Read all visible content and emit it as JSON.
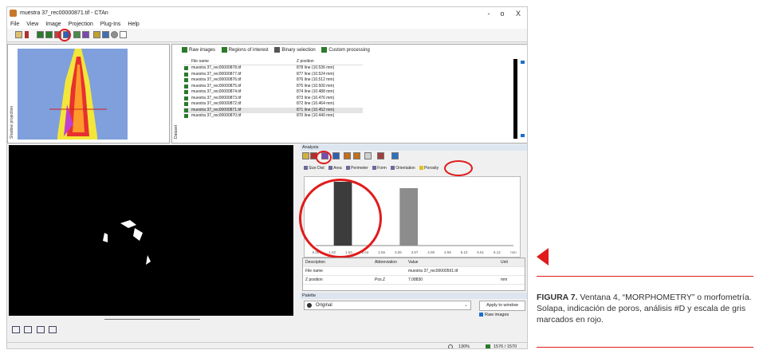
{
  "window": {
    "title": "muestra 37_rec00000871.tif - CTAn",
    "controls": [
      "-",
      "o",
      "X"
    ]
  },
  "menu": [
    "File",
    "View",
    "Image",
    "Projection",
    "Plug-Ins",
    "Help"
  ],
  "toolbar_icons": [
    "open-icon",
    "next-icon",
    "raw-image-icon",
    "roi-icon",
    "binary-icon",
    "processing-icon",
    "morphometry-icon",
    "3d-icon",
    "volume-render-icon",
    "chart-icon",
    "rotate-icon",
    "pointer-icon"
  ],
  "left_panel": {
    "label": "Shadow projection"
  },
  "dataset": {
    "label": "Dataset",
    "tabs": [
      "Raw images",
      "Regions of interest",
      "Binary selection",
      "Custom processing"
    ],
    "columns": [
      "File name",
      "Z position"
    ],
    "rows": [
      {
        "file": "muestra 37_rec00000878.tif",
        "z": "878 line (10.536 mm)"
      },
      {
        "file": "muestra 37_rec00000877.tif",
        "z": "877 line (10.524 mm)"
      },
      {
        "file": "muestra 37_rec00000876.tif",
        "z": "876 line (10.512 mm)"
      },
      {
        "file": "muestra 37_rec00000875.tif",
        "z": "875 line (10.500 mm)"
      },
      {
        "file": "muestra 37_rec00000874.tif",
        "z": "874 line (10.488 mm)"
      },
      {
        "file": "muestra 37_rec00000873.tif",
        "z": "873 line (10.476 mm)"
      },
      {
        "file": "muestra 37_rec00000872.tif",
        "z": "872 line (10.464 mm)"
      },
      {
        "file": "muestra 37_rec00000871.tif",
        "z": "871 line (10.452 mm)"
      },
      {
        "file": "muestra 37_rec00000870.tif",
        "z": "870 line (10.440 mm)"
      }
    ],
    "selected_index": 7
  },
  "analysis": {
    "title": "Analysis",
    "plugin_tabs": [
      "Size Dist",
      "Area",
      "Perimeter",
      "Form",
      "Orientation",
      "Porosity"
    ],
    "histogram": {
      "xticks": [
        "0.00",
        "1.02",
        "1.53",
        "2.04",
        "2.55",
        "3.06",
        "3.57",
        "4.08",
        "4.59",
        "5.10",
        "5.61",
        "6.12",
        "mm"
      ]
    },
    "table_header": {
      "description": "Description",
      "abbreviation": "Abbreviation",
      "value": "Value",
      "unit": "Unit"
    },
    "table_rows": [
      {
        "description": "File name",
        "abbreviation": "",
        "value": "muestra 37_rec00000591.tif",
        "unit": ""
      },
      {
        "description": "Z position",
        "abbreviation": "Pos.Z",
        "value": "7.08830",
        "unit": "mm"
      }
    ]
  },
  "palette": {
    "title": "Palette",
    "selected": "Original",
    "apply_button": "Apply to window",
    "checkbox_label": "Raw images"
  },
  "statusbar": {
    "zoom": "130%",
    "position": "1576 / 1570"
  },
  "caption": {
    "label": "FIGURA 7.",
    "text": "Ventana 4, “MORPHOMETRY” o morfometría. Solapa, indicación de poros, análisis #D y escala de gris marcados en rojo."
  },
  "chart_data": {
    "type": "bar",
    "categories": [
      "0.00",
      "1.02",
      "1.53",
      "2.04",
      "2.55",
      "3.06",
      "3.57",
      "4.08",
      "4.59",
      "5.10",
      "5.61",
      "6.12"
    ],
    "series": [
      {
        "values": [
          0,
          1,
          0,
          0,
          0,
          0.9,
          0,
          0,
          0,
          0,
          0,
          0
        ]
      }
    ],
    "colors": [
      "#3c3c3c",
      "#8c8c8c"
    ],
    "xlabel": "mm",
    "accent_color": "#e01b1b"
  }
}
